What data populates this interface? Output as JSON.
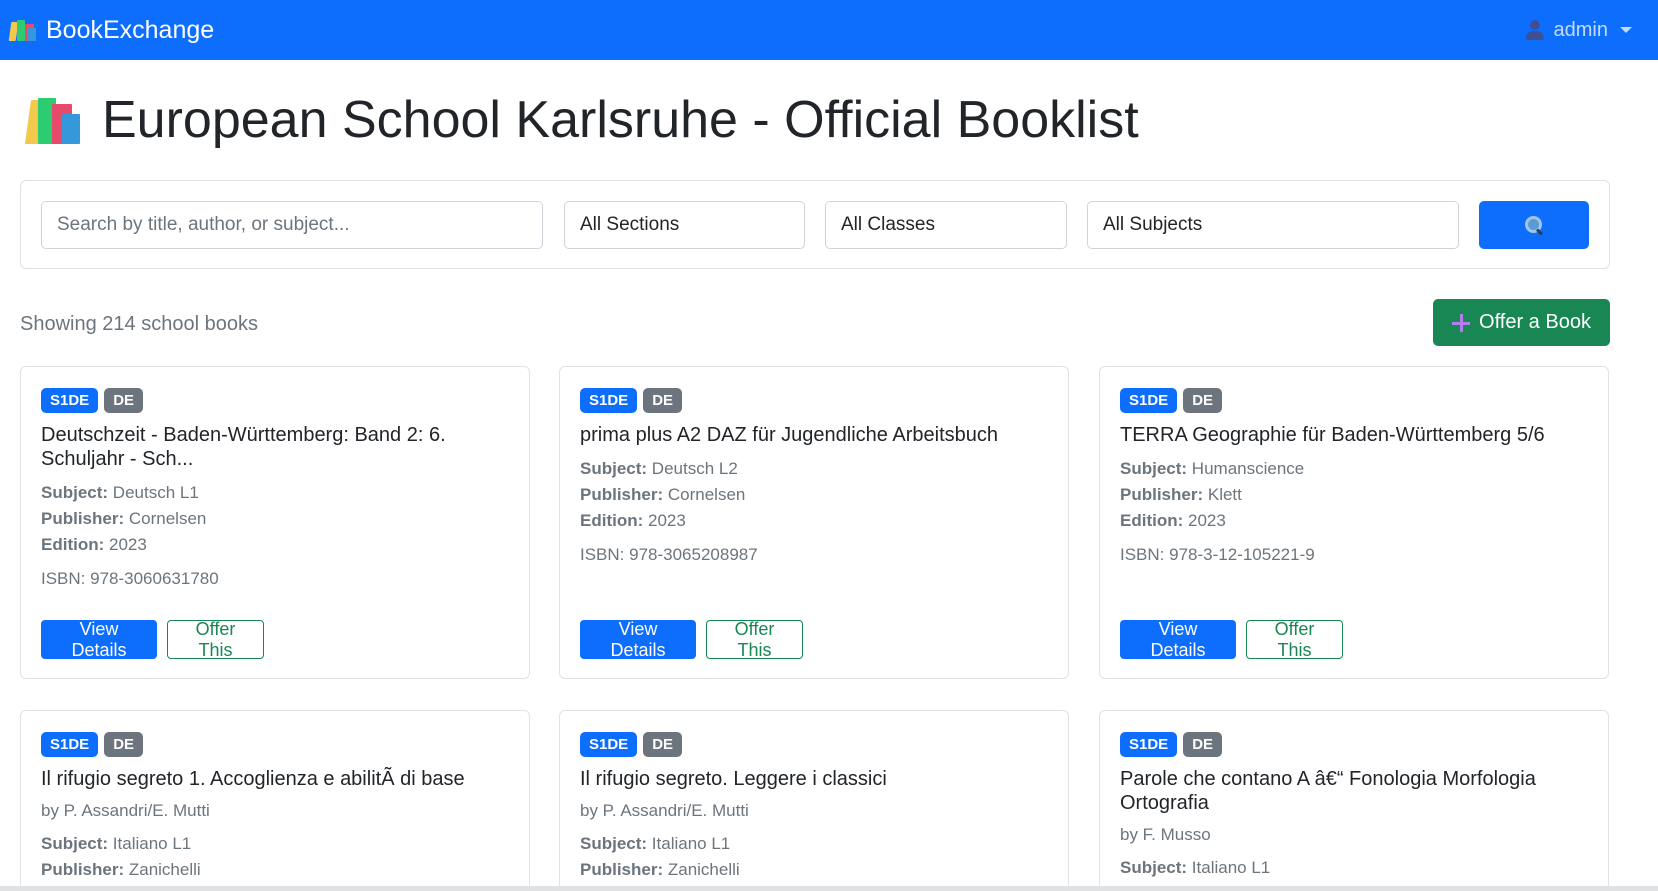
{
  "navbar": {
    "brand": "BookExchange",
    "brand_icon": "books-icon",
    "user": "admin",
    "user_icon": "user-icon",
    "color": "#0d6efd"
  },
  "page": {
    "title": "European School Karlsruhe - Official Booklist",
    "title_icon": "books-icon"
  },
  "filters": {
    "search_placeholder": "Search by title, author, or subject...",
    "sections": "All Sections",
    "classes": "All Classes",
    "subjects": "All Subjects",
    "search_button_icon": "magnifier-icon"
  },
  "results": {
    "count_text": "Showing 214 school books"
  },
  "offer_book": {
    "label": "Offer a Book",
    "icon": "plus-icon",
    "color": "#198754"
  },
  "labels": {
    "subject": "Subject:",
    "publisher": "Publisher:",
    "edition": "Edition:",
    "view_details": "View Details",
    "offer_this": "Offer This"
  },
  "books": [
    {
      "badge1": "S1DE",
      "badge2": "DE",
      "title": "Deutschzeit - Baden-Württemberg: Band 2: 6. Schuljahr - Sch...",
      "subject": "Deutsch L1",
      "publisher": "Cornelsen",
      "edition": "2023",
      "isbn": "ISBN: 978-3060631780"
    },
    {
      "badge1": "S1DE",
      "badge2": "DE",
      "title": "prima plus A2 DAZ für Jugendliche Arbeitsbuch",
      "subject": "Deutsch L2",
      "publisher": "Cornelsen",
      "edition": "2023",
      "isbn": "ISBN: 978-3065208987"
    },
    {
      "badge1": "S1DE",
      "badge2": "DE",
      "title": "TERRA Geographie für Baden-Württemberg 5/6",
      "subject": "Humanscience",
      "publisher": "Klett",
      "edition": "2023",
      "isbn": "ISBN: 978-3-12-105221-9"
    },
    {
      "badge1": "S1DE",
      "badge2": "DE",
      "title": "Il rifugio segreto 1. Accoglienza e abilitÃ  di base",
      "author": "by P. Assandri/E. Mutti",
      "subject": "Italiano L1",
      "publisher": "Zanichelli"
    },
    {
      "badge1": "S1DE",
      "badge2": "DE",
      "title": "Il rifugio segreto. Leggere i classici",
      "author": "by P. Assandri/E. Mutti",
      "subject": "Italiano L1",
      "publisher": "Zanichelli"
    },
    {
      "badge1": "S1DE",
      "badge2": "DE",
      "title": "Parole che contano A â€“ Fonologia Morfologia Ortografia",
      "author": "by F. Musso",
      "subject": "Italiano L1"
    }
  ]
}
